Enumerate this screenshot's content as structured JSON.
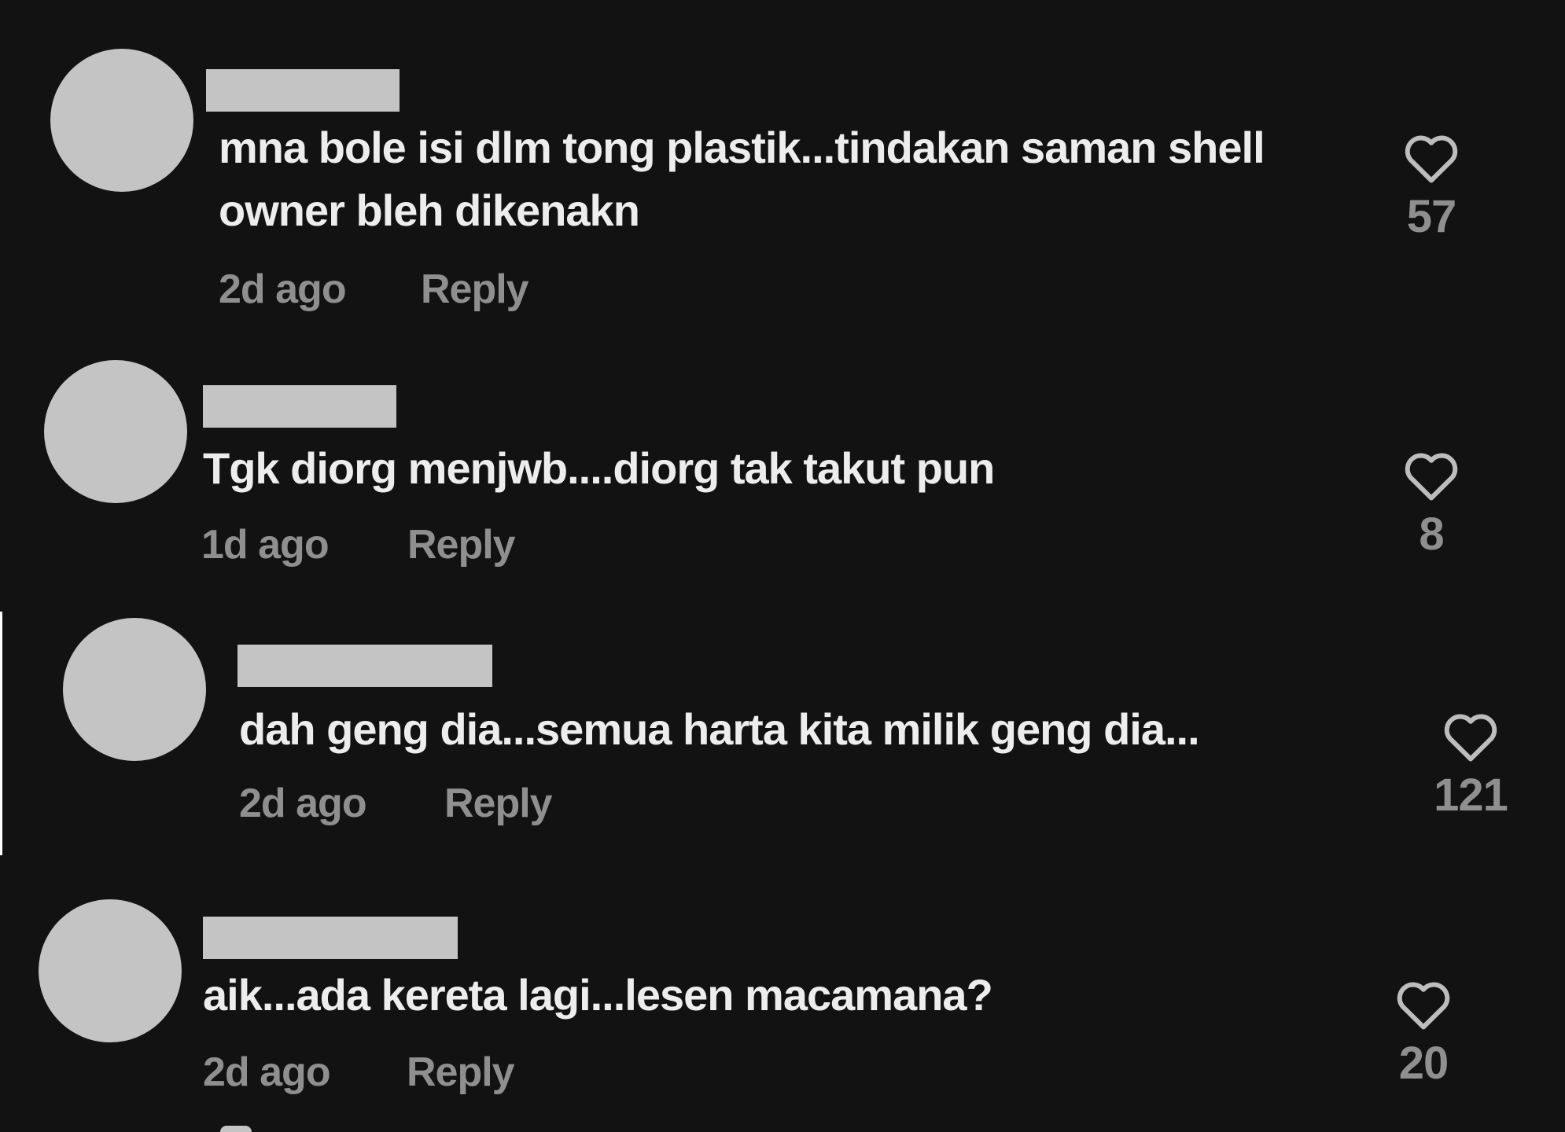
{
  "comments": [
    {
      "text": "mna bole isi dlm tong plastik...tindakan saman shell owner bleh dikenakn",
      "time": "2d ago",
      "reply_label": "Reply",
      "likes": "57"
    },
    {
      "text": "Tgk diorg menjwb....diorg tak takut pun",
      "time": "1d ago",
      "reply_label": "Reply",
      "likes": "8"
    },
    {
      "text": "dah geng dia...semua harta kita milik geng dia...",
      "time": "2d ago",
      "reply_label": "Reply",
      "likes": "121"
    },
    {
      "text": "aik...ada kereta lagi...lesen macamana?",
      "time": "2d ago",
      "reply_label": "Reply",
      "likes": "20"
    }
  ],
  "colors": {
    "background": "#121212",
    "text": "#ededed",
    "secondary_text": "#8f8f8f",
    "redaction": "#c4c4c4"
  },
  "icons": {
    "like": "heart-outline-icon"
  }
}
